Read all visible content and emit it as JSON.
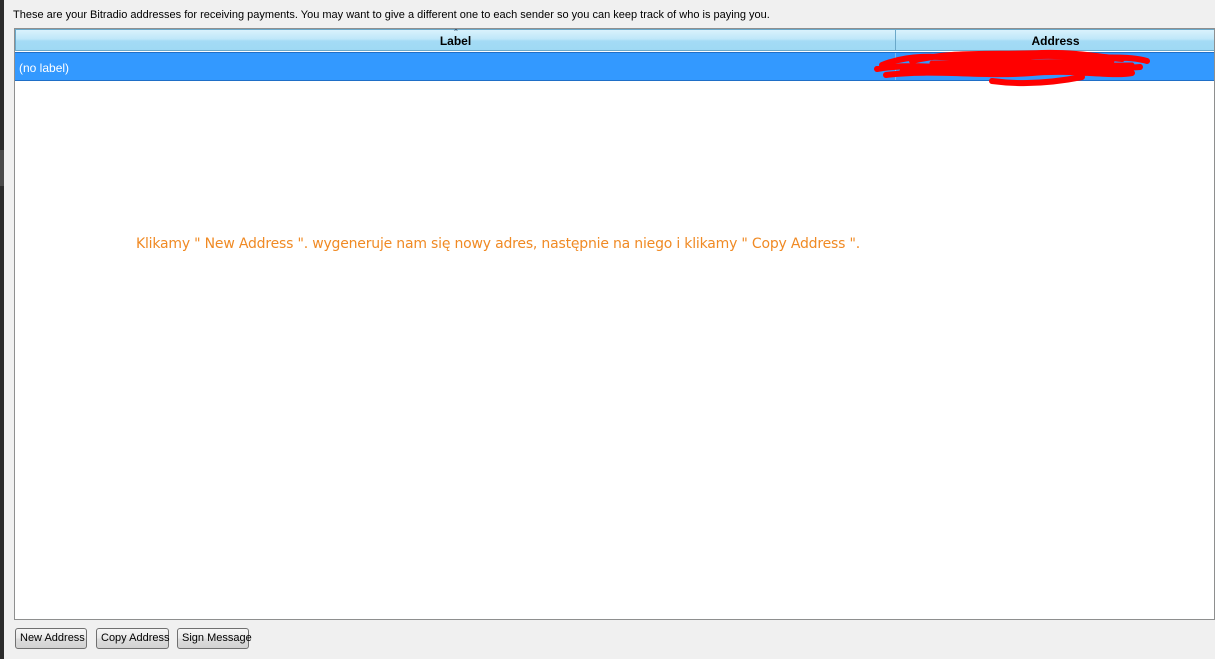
{
  "description": "These are your Bitradio addresses for receiving payments. You may want to give a different one to each sender so you can keep track of who is paying you.",
  "table": {
    "columns": [
      "Label",
      "Address"
    ],
    "rows": [
      {
        "label": "(no label)",
        "address_redacted": true
      }
    ],
    "selected_row_color": "#3399ff",
    "header_color": "#a4dbf5"
  },
  "annotation": {
    "text": "Klikamy \" New Address \". wygeneruje nam się nowy adres, następnie na niego i klikamy \" Copy Address \".",
    "color": "#f08a24"
  },
  "buttons": {
    "new_address": "New Address",
    "copy_address": "Copy Address",
    "sign_message": "Sign Message"
  },
  "icons": {
    "sort": "sort-indicator-icon"
  },
  "colors": {
    "redaction": "#ff0000"
  }
}
